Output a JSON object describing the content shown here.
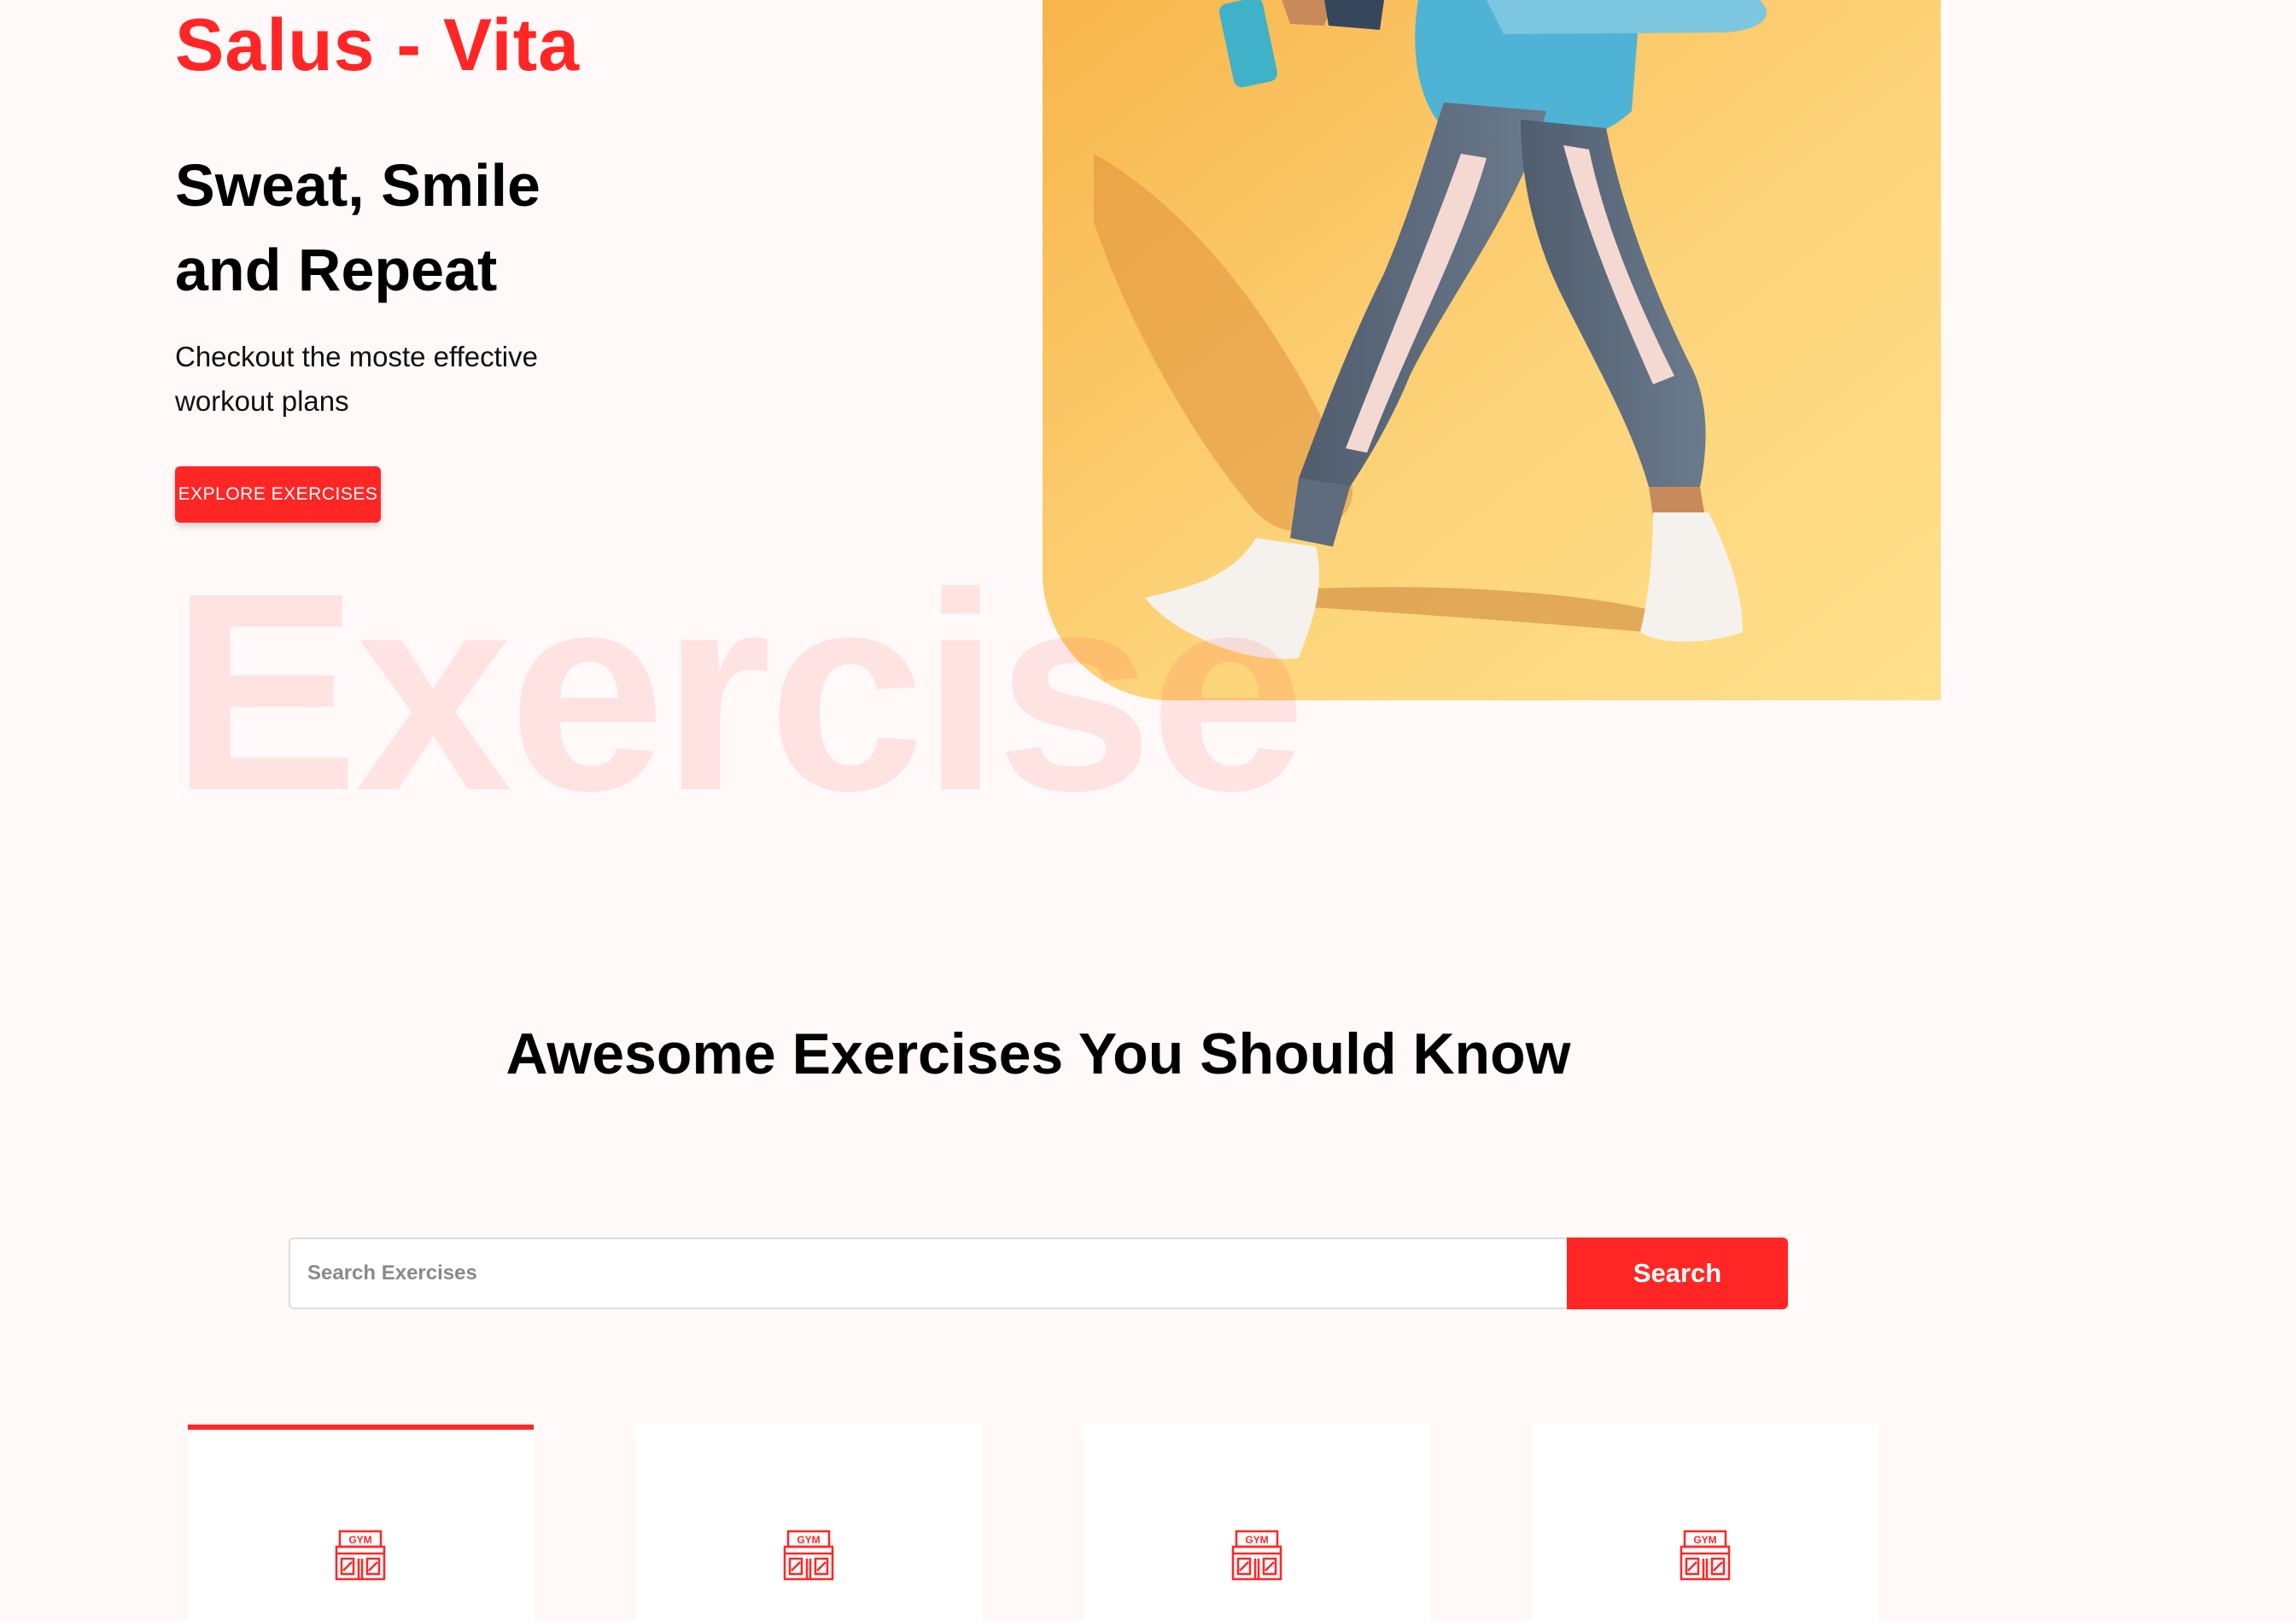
{
  "brand": {
    "name": "Salus - Vita",
    "color": "#ff2625"
  },
  "hero": {
    "title": "Sweat, Smile and Repeat",
    "subtitle": "Checkout the moste effective workout plans",
    "cta_label": "EXPLORE EXERCISES",
    "watermark": "Exercise",
    "image_icon": "hero-banner-image"
  },
  "exercises_section": {
    "title": "Awesome Exercises You Should Know",
    "search": {
      "placeholder": "Search Exercises",
      "value": "",
      "button_label": "Search"
    }
  },
  "body_part_cards": [
    {
      "icon": "gym-icon",
      "active": true
    },
    {
      "icon": "gym-icon",
      "active": false
    },
    {
      "icon": "gym-icon",
      "active": false
    },
    {
      "icon": "gym-icon",
      "active": false
    }
  ],
  "colors": {
    "accent": "#ff2625",
    "background": "#fff9f9",
    "hero_image_bg": "#fdd47a"
  }
}
